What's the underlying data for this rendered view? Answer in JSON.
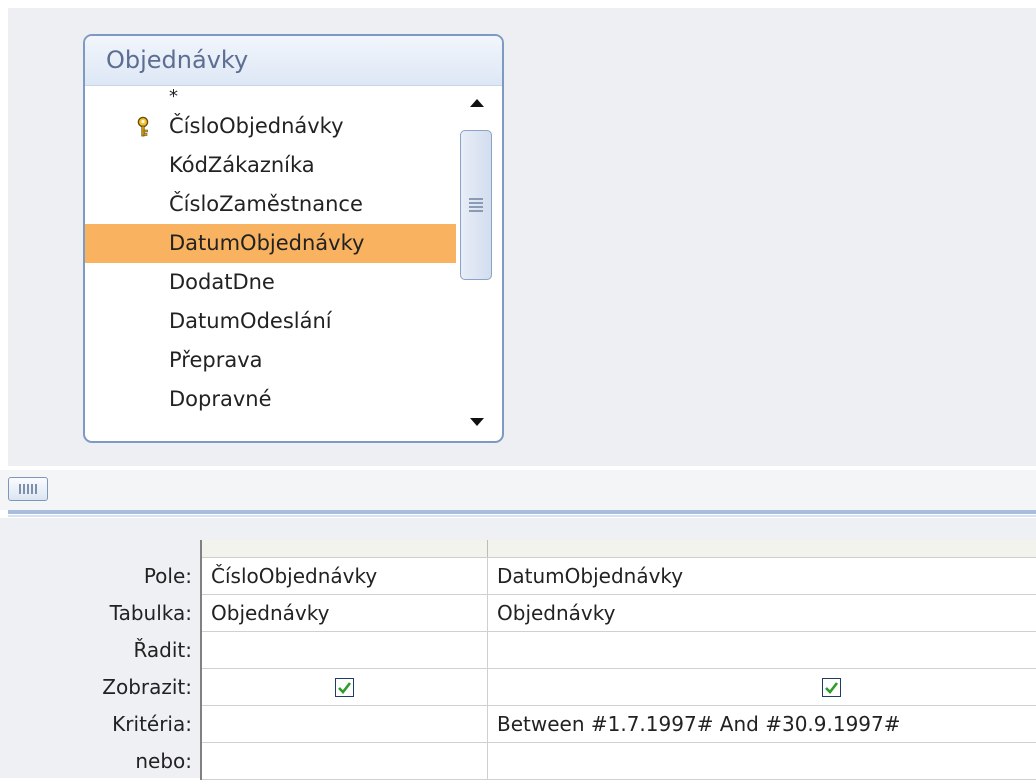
{
  "table": {
    "title": "Objednávky",
    "fields": [
      {
        "label": "*",
        "primary_key": false,
        "selected": false
      },
      {
        "label": "ČísloObjednávky",
        "primary_key": true,
        "selected": false
      },
      {
        "label": "KódZákazníka",
        "primary_key": false,
        "selected": false
      },
      {
        "label": "ČísloZaměstnance",
        "primary_key": false,
        "selected": false
      },
      {
        "label": "DatumObjednávky",
        "primary_key": false,
        "selected": true
      },
      {
        "label": "DodatDne",
        "primary_key": false,
        "selected": false
      },
      {
        "label": "DatumOdeslání",
        "primary_key": false,
        "selected": false
      },
      {
        "label": "Přeprava",
        "primary_key": false,
        "selected": false
      },
      {
        "label": "Dopravné",
        "primary_key": false,
        "selected": false
      }
    ]
  },
  "grid": {
    "row_labels": {
      "pole": "Pole:",
      "tabulka": "Tabulka:",
      "radit": "Řadit:",
      "zobrazit": "Zobrazit:",
      "kriteria": "Kritéria:",
      "nebo": "nebo:"
    },
    "columns": [
      {
        "pole": "ČísloObjednávky",
        "tabulka": "Objednávky",
        "radit": "",
        "zobrazit": true,
        "kriteria": "",
        "nebo": ""
      },
      {
        "pole": "DatumObjednávky",
        "tabulka": "Objednávky",
        "radit": "",
        "zobrazit": true,
        "kriteria": "Between #1.7.1997# And #30.9.1997#",
        "nebo": ""
      }
    ]
  },
  "colors": {
    "selected_field": "#f9b260",
    "table_border": "#7e99c4",
    "checkmark": "#2a9d2a"
  },
  "icons": {
    "primary_key": "key-icon",
    "scroll_up": "arrow-up-icon",
    "scroll_down": "arrow-down-icon",
    "splitter": "splitter-grip-icon"
  }
}
